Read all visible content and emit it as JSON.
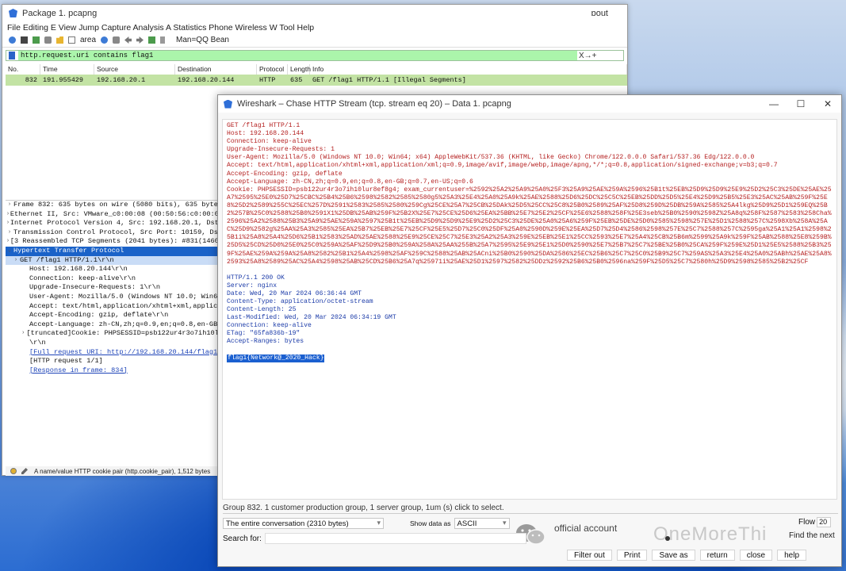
{
  "main": {
    "title": "Package 1. pcapng",
    "logout": "ɒout",
    "menu": "File Editing E View Jump Capture Analysis A Statistics Phone Wireless W Tool Help",
    "toolbar_text1": "area",
    "toolbar_text2": "Man=QQ Bean",
    "filter": {
      "value": "http.request.uri contains flag1",
      "right": "X→+"
    },
    "columns": [
      "No.",
      "Time",
      "Source",
      "Destination",
      "Protocol",
      "Length",
      "Info"
    ],
    "packet": {
      "no": "832",
      "time": "191.955429",
      "source": "192.168.20.1",
      "destination": "192.168.20.144",
      "protocol": "HTTP",
      "length": "635",
      "info": "GET /flag1 HTTP/1.1 [Illegal Segments]"
    },
    "details": [
      "Frame 832: 635 bytes on wire (5080 bits), 635 bytes",
      "Ethernet II, Src: VMware_c0:00:08 (00:50:56:c0:00:08",
      "Internet Protocol Version 4, Src: 192.168.20.1, Dst:",
      "Transmission Control Protocol, Src Port: 10159, Dst",
      "[3 Reassembled TCP Segments (2041 bytes): #831(1460)",
      "Hypertext Transfer Protocol",
      "GET /flag1 HTTP/1.1\\r\\n",
      "Host: 192.168.20.144\\r\\n",
      "Connection: keep-alive\\r\\n",
      "Upgrade-Insecure-Requests: 1\\r\\n",
      "User-Agent: Mozilla/5.0 (Windows NT 10.0; Win64;",
      "Accept: text/html,application/xhtml+xml,applicati",
      "Accept-Encoding: gzip, deflate\\r\\n",
      "Accept-Language: zh-CN,zh;q=0.9,en;q=0.8,en-GB;q=",
      "[truncated]Cookie: PHPSESSID=psb122ur4r3o7ih10lu",
      "\\r\\n",
      "[Full request URI: http://192.168.20.144/flag1]",
      "[HTTP request 1/1]",
      "[Response in frame: 834]"
    ],
    "status": "A name/value HTTP cookie pair (http.cookie_pair), 1,512 bytes"
  },
  "dialog": {
    "title": "Wireshark – Chase HTTP Stream (tcp. stream eq 20) – Data 1. pcapng",
    "minimize": "—",
    "maximize": "☐",
    "close": "✕",
    "request": [
      "GET /flag1 HTTP/1.1",
      "Host: 192.168.20.144",
      "Connection: keep-alive",
      "Upgrade-Insecure-Requests: 1",
      "User-Agent: Mozilla/5.0 (Windows NT 10.0; Win64; x64) AppleWebKit/537.36 (KHTML, like Gecko) Chrome/122.0.0.0 Safari/537.36 Edg/122.0.0.0",
      "Accept: text/html,application/xhtml+xml,application/xml;q=0.9,image/avif,image/webp,image/apng,*/*;q=0.8,application/signed-exchange;v=b3;q=0.7",
      "Accept-Encoding: gzip, deflate",
      "Accept-Language: zh-CN,zh;q=0.9,en;q=0.8,en-GB;q=0.7,en-US;q=0.6"
    ],
    "cookie": "Cookie: PHPSESSID=psb122ur4r3o7ih10lur8ef8g4; exam_currentuser=%2592%25A2%25A9%25A0%25F3%25A9%25AE%259A%2596%25B1t%25EB%25D9%25D9%25E9%25D2%25C3%25DE%25AE%25A7%2595%25E0%25D7%25CBC%25B4%25B6%2598%2582%2585%2580g5%25A3%25E4%25A0%25A9k%25AE%2588%25D6%25DC%25C5C%25EB%25DD%25D5%25E4%25D9%25B5%25E3%25AC%25AB%259F%25E8%25D2%2589%255C%25EC%257D%2591%2583%2585%2580%259Cg%25CE%25A7%25CB%25DAk%25D5%25CC%25C8%25B0%2589%25AF%25D8%259D%25DB%259A%2585%25A4lkg%25D9%25D1%259EQ%25B2%257B%25C0%2588%25B0%2591X1%25DB%25AB%259F%25B2X%25E7%25CE%25D6%25EA%25BB%25E7%25E2%25CF%25E6%2588%258F%25E3seb%25B0%2590%2598Z%25A8q%258F%2587%2583%258Cha%2596%25A2%2588%25B3%25A9%25AE%259A%2597%25B1t%25EB%25D9%25D9%25E9%25D2%25C3%25DE%25A0%25A6%259F%25EB%25DE%25D0%2585%2598%257E%25D1%2588%257C%2598Xb%258A%25AC%25D9%2582g%25AA%25A3%2585%25EA%25B7%25EB%25E7%25CF%25E5%25D7%25C0%25DF%25A0%2590D%259E%25EA%25D7%25D4%2586%2598%257E%25C7%2588%257C%2595ga%25A1%25A1%2598%25B1i%25A8%25A4%25D6%25B1%2583%25AD%25AE%2588%25E9%25CE%25C7%25E3%25A2%25A3%259E%25EB%25E1%25CC%2593%25E7%25A4%25CB%25B6m%2599%25A9k%259F%25AB%2588%25E8%259B%25D5%25CD%25D0%25E0%25C0%259A%25AF%25D9%25B0%259A%258A%25AA%255B%25A7%2595%25E9%25E1%25D0%2590%25E7%25B7%25C7%25BE%25B0%25CA%259F%259E%25D1%25E5%2588%25B3%259F%25AE%259A%259A%25A8%2582%25B1%25A4%2598%25AF%259C%2588%25AB%25ACni%25B0%2590%25DA%2586%25EC%25B6%25C7%25C0%25B9%25C7%259AS%25A3%25E4%25A0%25ABh%25AE%25A8%2593%25A8%2589%25AC%25A4%2598%25AB%25CD%25B6%25A7q%25971i%25AE%25D1%2597%2582%25DDz%2592%25B6%25B0%2596na%259F%25D5%25C7%2580h%25D9%2598%2585%25B2%25CF",
    "response": [
      "HTTP/1.1 200 OK",
      "Server: nginx",
      "Date: Wed, 20 Mar 2024 06:36:44 GMT",
      "Content-Type: application/octet-stream",
      "Content-Length: 25",
      "Last-Modified: Wed, 20 Mar 2024 06:34:19 GMT",
      "Connection: keep-alive",
      "ETag: \"65fa836b-19\"",
      "Accept-Ranges: bytes"
    ],
    "flag": "flag1{Network@_2020_Hack}",
    "status": "Group 832. 1 customer production group, 1 server group, 1um (s) click to select.",
    "conversation": "The entire conversation (2310 bytes)",
    "show_data_as_label": "Show data as",
    "show_data_as_value": "ASCII",
    "flow_label": "Flow",
    "flow_value": "20",
    "search_label": "Search for:",
    "find_next": "Find the next",
    "buttons": [
      "Filter out",
      "Print",
      "Save as",
      "return",
      "close",
      "help"
    ]
  },
  "watermark": {
    "official": "official account",
    "brand": "OneMoreThi"
  },
  "colors": {
    "filter_bg": "#abf5ab",
    "packet_row_bg": "#c3e3a4",
    "request_text": "#b41f1f",
    "response_text": "#1a3aa8",
    "selection": "#1a62c8"
  }
}
